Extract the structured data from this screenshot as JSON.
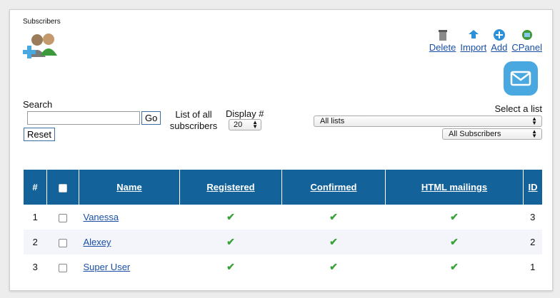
{
  "header": {
    "title": "Subscribers"
  },
  "toolbar": {
    "delete": "Delete",
    "import": "Import",
    "add": "Add",
    "cpanel": "CPanel"
  },
  "filters": {
    "search_label": "Search",
    "search_value": "",
    "go": "Go",
    "reset": "Reset",
    "list_all_subscribers": "List of all subscribers",
    "display_label": "Display #",
    "display_value": "20",
    "select_list_label": "Select a list",
    "list_value": "All lists",
    "subscriber_filter_value": "All Subscribers"
  },
  "table": {
    "columns": [
      "#",
      "",
      "Name",
      "Registered",
      "Confirmed",
      "HTML mailings",
      "ID"
    ],
    "rows": [
      {
        "num": "1",
        "name": "Vanessa",
        "registered": "✔",
        "confirmed": "✔",
        "html": "✔",
        "id": "3"
      },
      {
        "num": "2",
        "name": "Alexey",
        "registered": "✔",
        "confirmed": "✔",
        "html": "✔",
        "id": "2"
      },
      {
        "num": "3",
        "name": "Super User",
        "registered": "✔",
        "confirmed": "✔",
        "html": "✔",
        "id": "1"
      }
    ]
  },
  "colors": {
    "header_bg": "#13639a",
    "link": "#1a4fa3",
    "check": "#3aa33a",
    "mail_button": "#4aa8e0"
  }
}
